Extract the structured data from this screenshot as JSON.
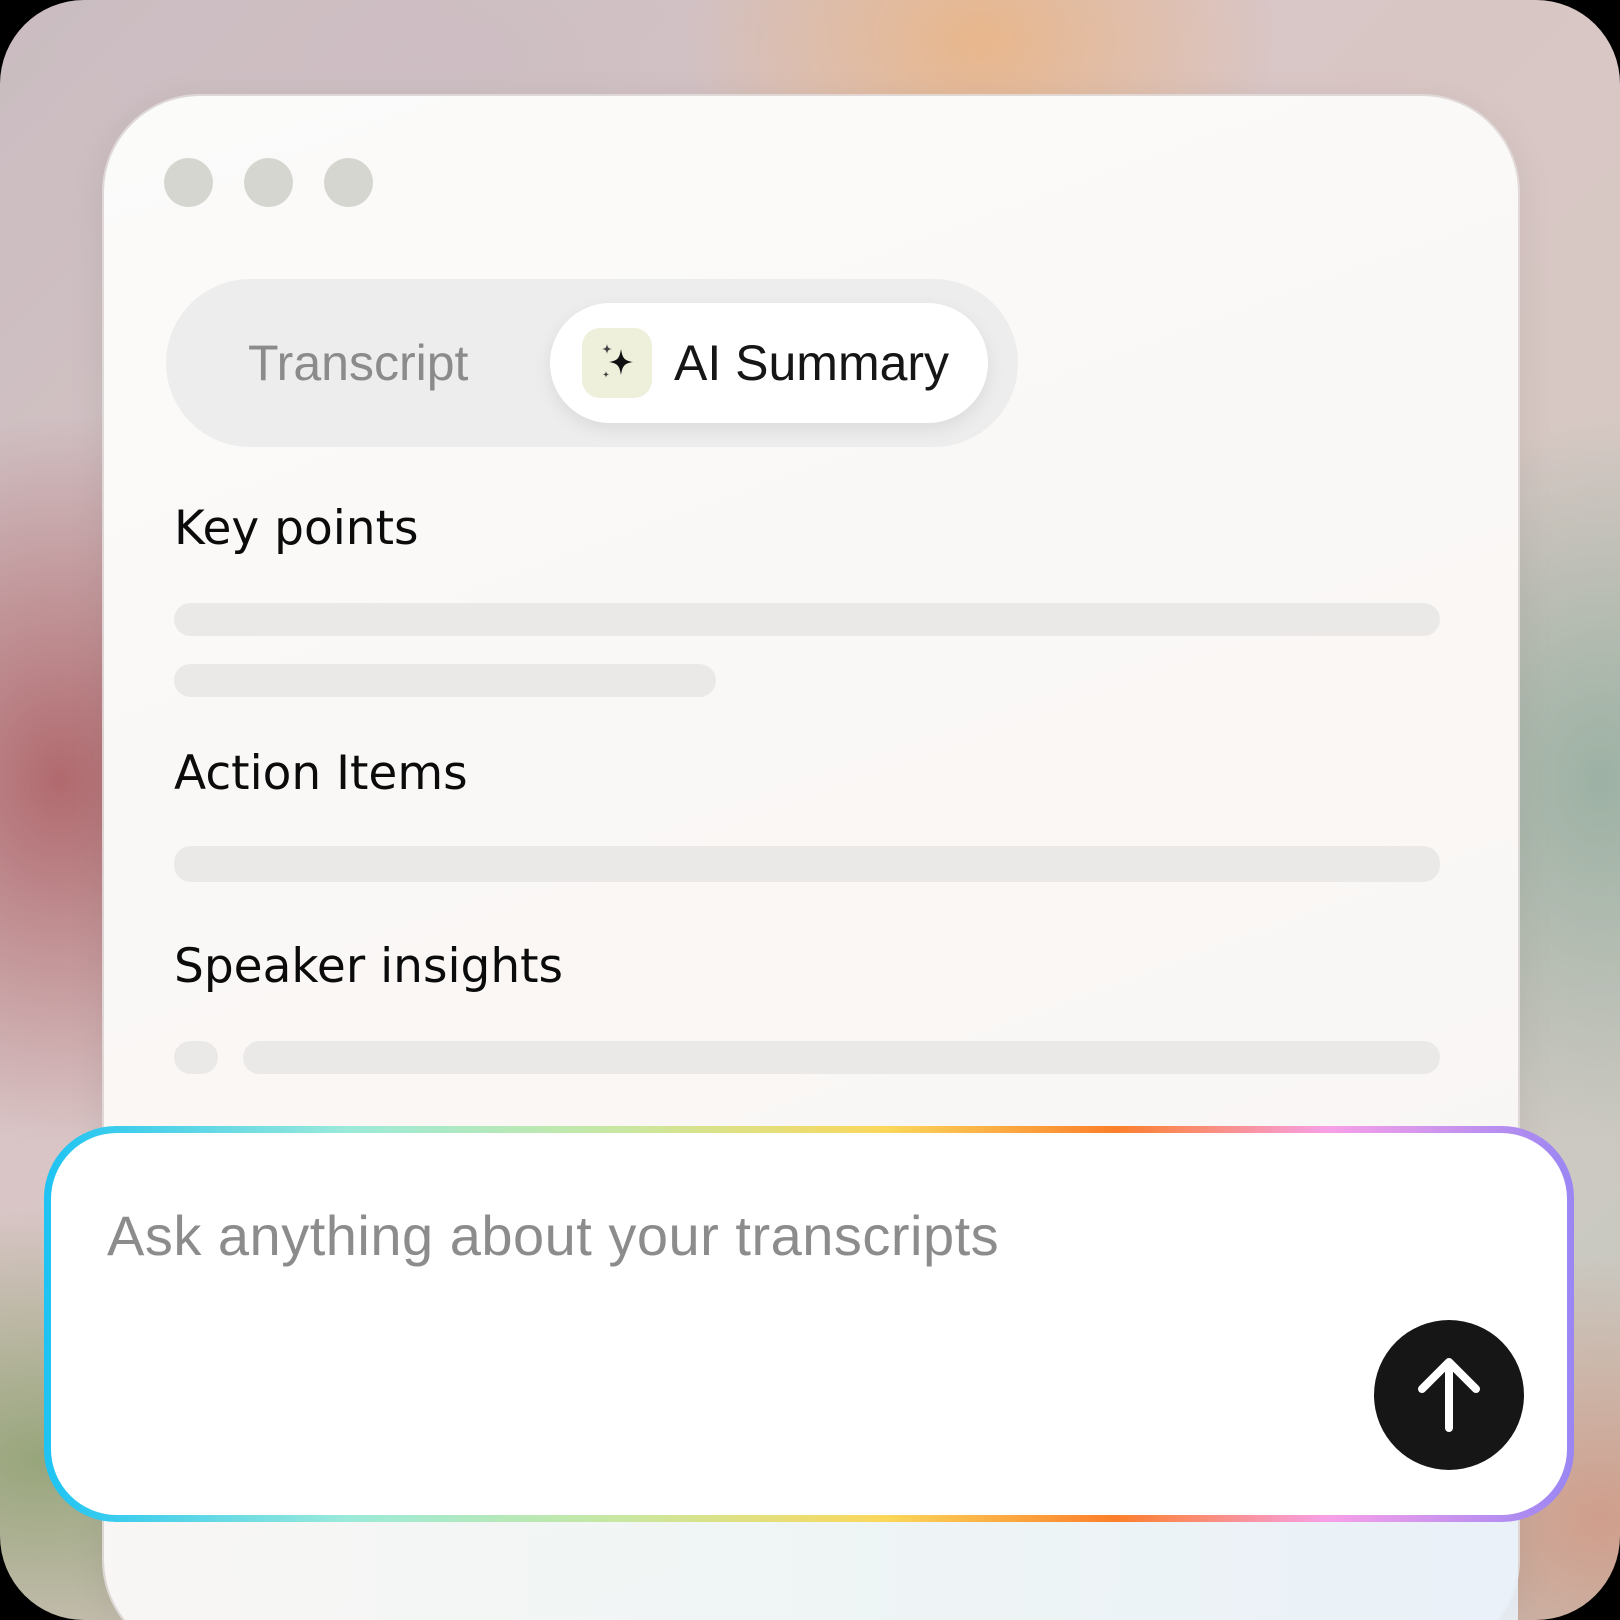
{
  "window": {
    "controls": [
      "window-dot",
      "window-dot",
      "window-dot"
    ]
  },
  "tabs": {
    "transcript_label": "Transcript",
    "summary_label": "AI Summary",
    "summary_icon": "sparkle-icon",
    "active": "AI Summary"
  },
  "sections": {
    "key_points": {
      "title": "Key points"
    },
    "action_items": {
      "title": "Action Items"
    },
    "speaker_insights": {
      "title": "Speaker insights"
    }
  },
  "composer": {
    "placeholder": "Ask anything about your transcripts",
    "send_icon": "arrow-up-icon"
  },
  "colors": {
    "send_button": "#161616",
    "accent_gradient": [
      "#1ec3f3",
      "#9cead9",
      "#c9e7a0",
      "#fbd75a",
      "#fb7f2a",
      "#f7a0e8",
      "#9a86f3"
    ]
  }
}
